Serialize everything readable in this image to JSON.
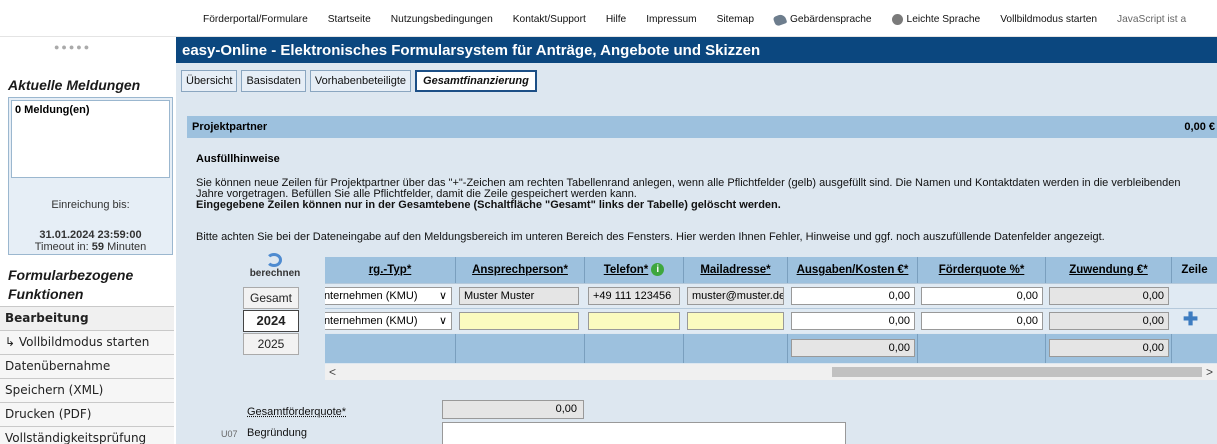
{
  "topnav": {
    "links": [
      "Förderportal/Formulare",
      "Startseite",
      "Nutzungsbedingungen",
      "Kontakt/Support",
      "Hilfe",
      "Impressum",
      "Sitemap"
    ],
    "gebaerden": "Gebärdensprache",
    "leichte": "Leichte Sprache",
    "vollbild": "Vollbildmodus starten",
    "js": "JavaScript ist a"
  },
  "app_title": "easy-Online - Elektronisches Formularsystem für Anträge, Angebote und Skizzen",
  "sidebar": {
    "dots": "●●●●●",
    "meldungen_title": "Aktuelle Meldungen",
    "meldungen_count": "0 Meldung(en)",
    "einreichung_label": "Einreichung bis:",
    "einreichung_date": "31.01.2024 23:59:00",
    "timeout_prefix": "Timeout in: ",
    "timeout_value": "59",
    "timeout_suffix": " Minuten",
    "func_title": "Formularbezogene Funktionen",
    "menu": [
      "Bearbeitung",
      "↳ Vollbildmodus starten",
      "Datenübernahme",
      "Speichern (XML)",
      "Drucken (PDF)",
      "Vollständigkeitsprüfung"
    ]
  },
  "tabs": [
    "Übersicht",
    "Basisdaten",
    "Vorhabenbeteiligte",
    "Gesamtfinanzierung"
  ],
  "section": {
    "title": "Projektpartner",
    "total": "0,00 €",
    "ausfuell": "Ausfüllhinweise",
    "para1": "Sie können neue Zeilen für Projektpartner über das \"+\"-Zeichen am rechten Tabellenrand anlegen, wenn alle Pflichtfelder (gelb) ausgefüllt sind. Die Namen und Kontaktdaten werden in die verbleibenden Jahre vorgetragen. Befüllen Sie alle Pflichtfelder, damit die Zeile gespeichert werden kann.",
    "para1_bold": "Eingegebene Zeilen können nur in der Gesamtebene (Schaltfläche \"Gesamt\" links der Tabelle) gelöscht werden.",
    "para2": "Bitte achten Sie bei der Dateneingabe auf den Meldungsbereich im unteren Bereich des Fensters. Hier werden Ihnen Fehler, Hinweise und ggf. noch auszufüllende Datenfelder angezeigt."
  },
  "berechnen": {
    "label": "berechnen",
    "years": [
      "Gesamt",
      "2024",
      "2025"
    ]
  },
  "table": {
    "headers": [
      "rg.-Typ*",
      "Ansprechperson*",
      "Telefon*",
      "Mailadresse*",
      "Ausgaben/Kosten €*",
      "Förderquote %*",
      "Zuwendung €*",
      "Zeile"
    ],
    "rows": [
      {
        "typ": "Unternehmen (KMU)",
        "person": "Muster Muster",
        "tel": "+49 111 123456",
        "mail": "muster@muster.de",
        "ausgaben": "0,00",
        "quote": "0,00",
        "zuwendung": "0,00"
      },
      {
        "typ": "Unternehmen (KMU)",
        "person": "",
        "tel": "",
        "mail": "",
        "ausgaben": "0,00",
        "quote": "0,00",
        "zuwendung": "0,00"
      }
    ],
    "sum_ausgaben": "0,00",
    "sum_zuwendung": "0,00"
  },
  "footer": {
    "gq_label": "Gesamtförderquote*",
    "gq_value": "0,00",
    "u07": "U07",
    "begruendung": "Begründung"
  }
}
